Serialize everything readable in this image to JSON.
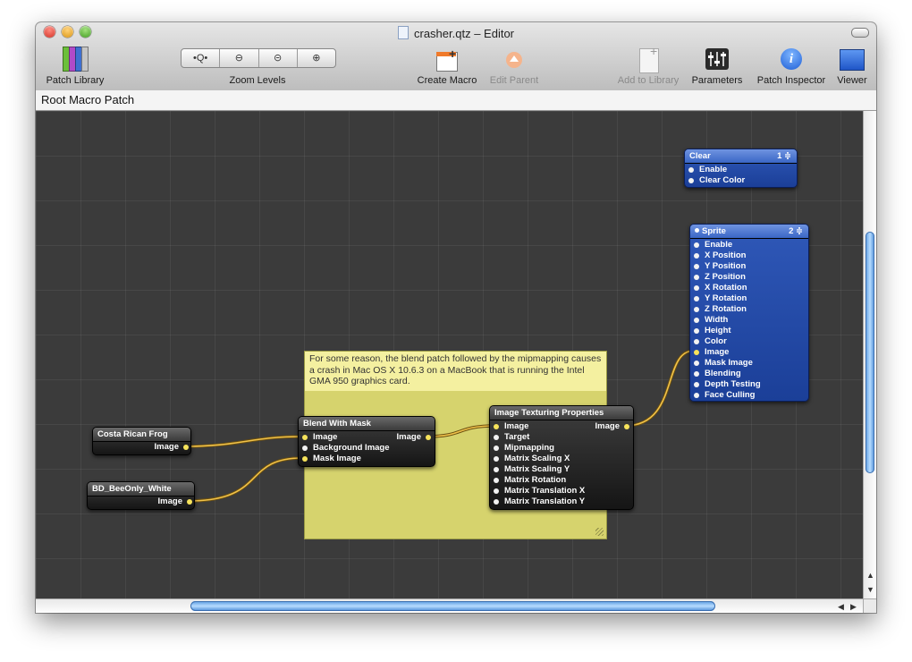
{
  "window": {
    "title": "crasher.qtz – Editor"
  },
  "toolbar": {
    "patch_library": "Patch Library",
    "zoom_levels": "Zoom Levels",
    "zoom_buttons": [
      "•Q•",
      "⊖",
      "⊝",
      "⊕"
    ],
    "create_macro": "Create Macro",
    "edit_parent": "Edit Parent",
    "add_to_library": "Add to Library",
    "parameters": "Parameters",
    "patch_inspector": "Patch Inspector",
    "viewer": "Viewer"
  },
  "path": {
    "label": "Root Macro Patch"
  },
  "note": {
    "text": "For some reason, the blend patch followed by the mipmapping causes a crash in Mac OS X 10.6.3 on a MacBook that is running the Intel GMA 950 graphics card."
  },
  "patches": {
    "frog": {
      "title": "Costa Rican Frog",
      "output": "Image"
    },
    "bee": {
      "title": "BD_BeeOnly_White",
      "output": "Image"
    },
    "blend": {
      "title": "Blend With Mask",
      "inputs": [
        "Image",
        "Background Image",
        "Mask Image"
      ],
      "output": "Image"
    },
    "texture": {
      "title": "Image Texturing Properties",
      "inputs": [
        "Image",
        "Target",
        "Mipmapping",
        "Matrix Scaling X",
        "Matrix Scaling Y",
        "Matrix Rotation",
        "Matrix Translation X",
        "Matrix Translation Y"
      ],
      "output": "Image"
    },
    "clear": {
      "title": "Clear",
      "index": "1 ≑",
      "inputs": [
        "Enable",
        "Clear Color"
      ]
    },
    "sprite": {
      "title": "Sprite",
      "index": "2 ≑",
      "inputs": [
        "Enable",
        "X Position",
        "Y Position",
        "Z Position",
        "X Rotation",
        "Y Rotation",
        "Z Rotation",
        "Width",
        "Height",
        "Color",
        "Image",
        "Mask Image",
        "Blending",
        "Depth Testing",
        "Face Culling"
      ]
    }
  },
  "colors": {
    "canvas": "#3b3b3b",
    "wire": "#f0c24a",
    "note": "#d6d36d"
  }
}
